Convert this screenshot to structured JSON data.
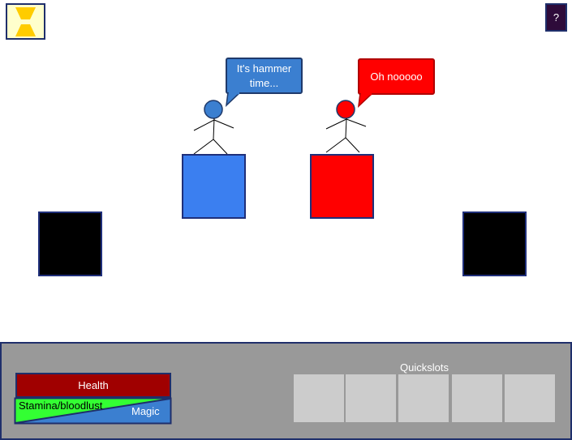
{
  "top_bar": {
    "hourglass_icon": "hourglass-icon",
    "help_label": "?"
  },
  "characters": {
    "blue": {
      "speech": "It's hammer time...",
      "color": "#3b7fd0"
    },
    "red": {
      "speech": "Oh nooooo",
      "color": "#ff0000"
    }
  },
  "hud": {
    "health_label": "Health",
    "stamina_label": "Stamina/bloodlust",
    "magic_label": "Magic",
    "quickslots_title": "Quickslots",
    "slots": [
      "",
      "",
      "",
      "",
      ""
    ]
  },
  "colors": {
    "hud_background": "#999999",
    "health": "#a00000",
    "stamina": "#33ff33",
    "magic": "#3b7fd0"
  }
}
